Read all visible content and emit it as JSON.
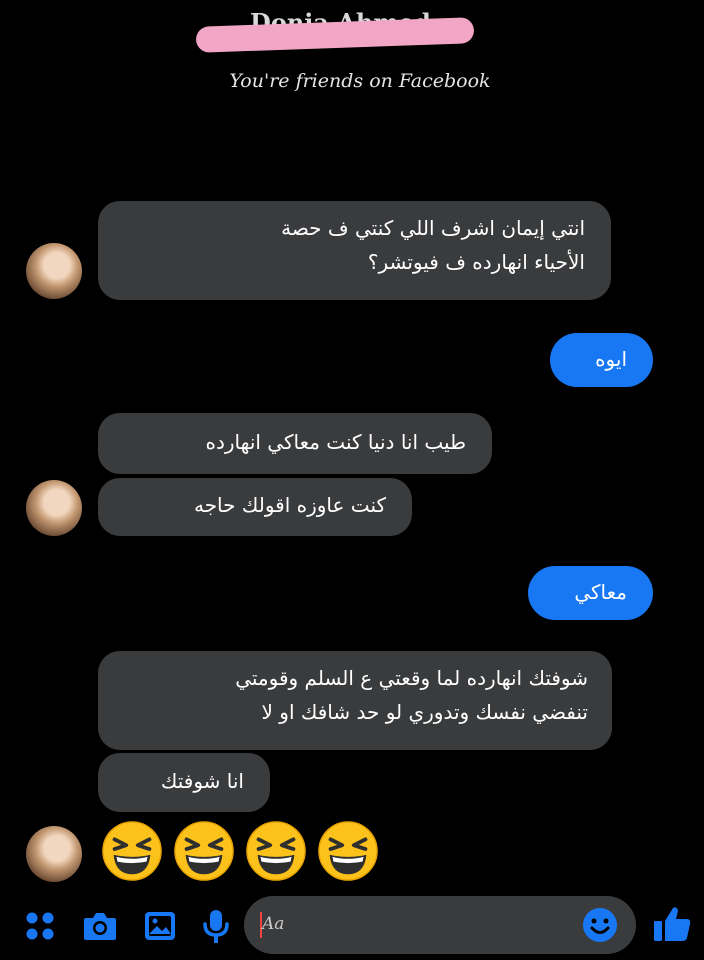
{
  "header": {
    "contact_name_obscured": "Donia Ahmed",
    "subtitle": "You're friends on Facebook"
  },
  "messages": [
    {
      "side": "incoming",
      "lines": [
        "انتي إيمان اشرف اللي كنتي ف حصة",
        "الأحياء انهارده ف فيوتشر؟"
      ]
    },
    {
      "side": "outgoing",
      "lines": [
        "ايوه"
      ]
    },
    {
      "side": "incoming",
      "lines": [
        "طيب انا دنيا كنت معاكي انهارده"
      ]
    },
    {
      "side": "incoming",
      "lines": [
        "كنت عاوزه اقولك حاجه"
      ]
    },
    {
      "side": "outgoing",
      "lines": [
        "معاكي"
      ]
    },
    {
      "side": "incoming",
      "lines": [
        "شوفتك انهارده لما وقعتي ع السلم وقومتي",
        "تنفضي نفسك وتدوري لو حد شافك او لا"
      ]
    },
    {
      "side": "incoming",
      "lines": [
        "انا شوفتك"
      ]
    },
    {
      "side": "incoming",
      "emoji": [
        "laughing-emoji",
        "laughing-emoji",
        "laughing-emoji",
        "laughing-emoji"
      ]
    }
  ],
  "composer": {
    "placeholder": "Aa",
    "icons": [
      "grid-menu-icon",
      "camera-icon",
      "gallery-icon",
      "microphone-icon",
      "emoji-smile-icon",
      "thumbs-up-icon"
    ]
  },
  "colors": {
    "background": "#000000",
    "incoming_bubble": "#3a3b3d",
    "outgoing_bubble": "#1877f2",
    "accent": "#1877f2",
    "name_scribble": "#f2a6c6"
  }
}
